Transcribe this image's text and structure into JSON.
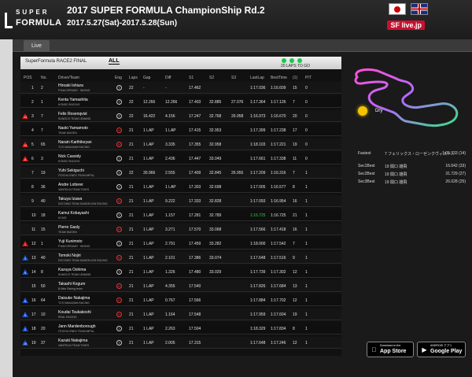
{
  "header": {
    "logo_line1": "SUPER",
    "logo_line2": "FORMULA",
    "title": "2017 SUPER FORMULA ChampionShip Rd.2",
    "dates": "2017.5.27(Sat)-2017.5.28(Sun)",
    "live_logo": "SF live.jp"
  },
  "tabs": {
    "live": "Live"
  },
  "panel": {
    "race_name": "SuperFormula RACE2 FINAL",
    "filter": "ALL",
    "laps_to_go": "20 LAPS TO GO"
  },
  "columns": [
    "POS",
    "No.",
    "Driver/Team",
    "Eng",
    "Laps",
    "Gap",
    "Diff",
    "S1",
    "S2",
    "S3",
    "LastLap",
    "BestTime",
    "(1)",
    "PIT"
  ],
  "rows": [
    {
      "badge": "",
      "badge_color": "",
      "pos": "1",
      "no": "2",
      "name": "Hiroaki Ishiura",
      "team": "P.MU/CERUMO · INGING",
      "eng": "T",
      "laps": "22",
      "gap": "-",
      "diff": "-",
      "s1": "17.462",
      "s2": "",
      "s3": "",
      "last": "1:17.036",
      "best": "1:16.609",
      "c1": "15",
      "pit": "0"
    },
    {
      "badge": "",
      "badge_color": "",
      "pos": "2",
      "no": "1",
      "name": "Kenta Yamashita",
      "team": "KONDO RACING",
      "eng": "T",
      "laps": "22",
      "gap": "12.266",
      "diff": "12.266",
      "s1": "17.403",
      "s2": "32.885",
      "s3": "27.076",
      "last": "1:17.364",
      "best": "1:17.126",
      "c1": "7",
      "pit": "0"
    },
    {
      "badge": "13",
      "badge_color": "red",
      "pos": "3",
      "no": "7",
      "name": "Felix Rosenqvist",
      "team": "SUNOCO TEAM LEMANS",
      "eng": "T",
      "laps": "22",
      "gap": "16.422",
      "diff": "4.156",
      "s1": "17.247",
      "s2": "32.768",
      "s3": "26.958",
      "last": "1:16.973",
      "best": "1:16.670",
      "c1": "20",
      "pit": "0"
    },
    {
      "badge": "",
      "badge_color": "",
      "pos": "4",
      "no": "7",
      "name": "Naoki Yamamoto",
      "team": "TEAM MUGEN",
      "eng": "H",
      "laps": "21",
      "gap": "1 LAP",
      "diff": "1 LAP",
      "s1": "17.415",
      "s2": "32.953",
      "s3": "",
      "last": "1:17.399",
      "best": "1:17.238",
      "c1": "17",
      "pit": "0"
    },
    {
      "badge": "13",
      "badge_color": "red",
      "pos": "5",
      "no": "65",
      "name": "Narain Karthikeyan",
      "team": "TCS NAKAJIMA RACING",
      "eng": "H",
      "laps": "21",
      "gap": "1 LAP",
      "diff": "3.335",
      "s1": "17.355",
      "s2": "32.958",
      "s3": "",
      "last": "1:18.103",
      "best": "1:17.221",
      "c1": "19",
      "pit": "0"
    },
    {
      "badge": "11",
      "badge_color": "red",
      "pos": "6",
      "no": "3",
      "name": "Nick Cassidy",
      "team": "KONDO RACING",
      "eng": "T",
      "laps": "21",
      "gap": "1 LAP",
      "diff": "2.436",
      "s1": "17.447",
      "s2": "33.049",
      "s3": "",
      "last": "1:17.661",
      "best": "1:17.338",
      "c1": "11",
      "pit": "0"
    },
    {
      "badge": "",
      "badge_color": "",
      "pos": "7",
      "no": "19",
      "name": "Yuhi Sekiguchi",
      "team": "ITOCHU ENEX TEAM IMPUL",
      "eng": "T",
      "laps": "22",
      "gap": "30.966",
      "diff": "2.555",
      "s1": "17.409",
      "s2": "32.845",
      "s3": "26.955",
      "last": "1:17.209",
      "best": "1:16.316",
      "c1": "7",
      "pit": "1"
    },
    {
      "badge": "",
      "badge_color": "",
      "pos": "8",
      "no": "36",
      "name": "Andre Lotterer",
      "team": "VANTELIN TEAM TOM'S",
      "eng": "T",
      "laps": "21",
      "gap": "1 LAP",
      "diff": "1 LAP",
      "s1": "17.303",
      "s2": "32.698",
      "s3": "",
      "last": "1:17.005",
      "best": "1:16.577",
      "c1": "8",
      "pit": "1"
    },
    {
      "badge": "",
      "badge_color": "",
      "pos": "9",
      "no": "40",
      "name": "Takuya Izawa",
      "team": "DOCOMO TEAM DANDELION RACING",
      "eng": "H",
      "laps": "21",
      "gap": "1 LAP",
      "diff": "9.222",
      "s1": "17.333",
      "s2": "32.828",
      "s3": "",
      "last": "1:17.093",
      "best": "1:16.954",
      "c1": "16",
      "pit": "1"
    },
    {
      "badge": "",
      "badge_color": "",
      "pos": "10",
      "no": "18",
      "name": "Kamui Kobayashi",
      "team": "KCMG",
      "eng": "T",
      "laps": "21",
      "gap": "1 LAP",
      "diff": "1.157",
      "s1": "17.281",
      "s2": "32.789",
      "s3": "",
      "last": "1:16.725",
      "best": "1:16.725",
      "c1": "21",
      "pit": "1",
      "last_green": true
    },
    {
      "badge": "",
      "badge_color": "",
      "pos": "11",
      "no": "15",
      "name": "Pierre Gasly",
      "team": "TEAM MUGEN",
      "eng": "H",
      "laps": "21",
      "gap": "1 LAP",
      "diff": "3.271",
      "s1": "17.570",
      "s2": "33.068",
      "s3": "",
      "last": "1:17.566",
      "best": "1:17.418",
      "c1": "16",
      "pit": "1"
    },
    {
      "badge": "1",
      "badge_color": "red",
      "pos": "12",
      "no": "1",
      "name": "Yuji Kunimoto",
      "team": "P.MU/CERUMO · INGING",
      "eng": "T",
      "laps": "21",
      "gap": "1 LAP",
      "diff": "2.791",
      "s1": "17.459",
      "s2": "33.282",
      "s3": "",
      "last": "1:18.000",
      "best": "1:17.542",
      "c1": "7",
      "pit": "1"
    },
    {
      "badge": "3",
      "badge_color": "blue",
      "pos": "13",
      "no": "40",
      "name": "Tomoki Nojiri",
      "team": "DOCOMO TEAM DANDELION RACING",
      "eng": "H",
      "laps": "21",
      "gap": "1 LAP",
      "diff": "2.101",
      "s1": "17.386",
      "s2": "33.074",
      "s3": "",
      "last": "1:17.648",
      "best": "1:17.516",
      "c1": "9",
      "pit": "1"
    },
    {
      "badge": "5",
      "badge_color": "blue",
      "pos": "14",
      "no": "8",
      "name": "Kazuya Oshima",
      "team": "SUNOCO TEAM LEMANS",
      "eng": "T",
      "laps": "21",
      "gap": "1 LAP",
      "diff": "1.326",
      "s1": "17.480",
      "s2": "33.029",
      "s3": "",
      "last": "1:17.739",
      "best": "1:17.302",
      "c1": "12",
      "pit": "1"
    },
    {
      "badge": "",
      "badge_color": "",
      "pos": "15",
      "no": "50",
      "name": "Takashi Kogure",
      "team": "B-Max Racing team",
      "eng": "H",
      "laps": "21",
      "gap": "1 LAP",
      "diff": "4.355",
      "s1": "17.540",
      "s2": "",
      "s3": "",
      "last": "1:17.826",
      "best": "1:17.684",
      "c1": "13",
      "pit": "1"
    },
    {
      "badge": "6",
      "badge_color": "blue",
      "pos": "16",
      "no": "64",
      "name": "Daisuke Nakajima",
      "team": "TCS NAKAJIMA RACING",
      "eng": "H",
      "laps": "21",
      "gap": "1 LAP",
      "diff": "0.767",
      "s1": "17.566",
      "s2": "",
      "s3": "",
      "last": "1:17.884",
      "best": "1:17.702",
      "c1": "12",
      "pit": "1"
    },
    {
      "badge": "5",
      "badge_color": "blue",
      "pos": "17",
      "no": "10",
      "name": "Koudai Tsukakoshi",
      "team": "REAL RACING",
      "eng": "H",
      "laps": "21",
      "gap": "1 LAP",
      "diff": "1.164",
      "s1": "17.548",
      "s2": "",
      "s3": "",
      "last": "1:17.959",
      "best": "1:17.604",
      "c1": "19",
      "pit": "1"
    },
    {
      "badge": "2",
      "badge_color": "blue",
      "pos": "18",
      "no": "20",
      "name": "Jann Mardenborough",
      "team": "ITOCHU ENEX TEAM IMPUL",
      "eng": "T",
      "laps": "21",
      "gap": "1 LAP",
      "diff": "2.263",
      "s1": "17.504",
      "s2": "",
      "s3": "",
      "last": "1:18.329",
      "best": "1:17.834",
      "c1": "8",
      "pit": "1"
    },
    {
      "badge": "10",
      "badge_color": "blue",
      "pos": "19",
      "no": "37",
      "name": "Kazuki Nakajima",
      "team": "VANTELIN TEAM TOM'S",
      "eng": "T",
      "laps": "21",
      "gap": "1 LAP",
      "diff": "2.005",
      "s1": "17.315",
      "s2": "",
      "s3": "",
      "last": "1:17.648",
      "best": "1:17.246",
      "c1": "12",
      "pit": "1"
    }
  ],
  "weather": {
    "label": "Dry"
  },
  "records": [
    {
      "k": "Fastest",
      "n": "7 フェリックス・ローゼンクヴィスト...",
      "v": "1:05.933 (14)"
    },
    {
      "k": "Sec1Best",
      "n": "19 関口 雄飛",
      "v": "16.642 (33)"
    },
    {
      "k": "Sec2Best",
      "n": "19 関口 雄飛",
      "v": "31.729 (27)"
    },
    {
      "k": "Sec3Best",
      "n": "19 関口 雄飛",
      "v": "26.028 (25)"
    }
  ],
  "stores": {
    "app_small": "Download on the",
    "app_big": "App Store",
    "play_small": "ANDROID アプリ",
    "play_big": "Google Play"
  },
  "colors": {
    "accent_red": "#d11111",
    "accent_blue": "#1b4fcf",
    "best_green": "#2ed14a"
  }
}
